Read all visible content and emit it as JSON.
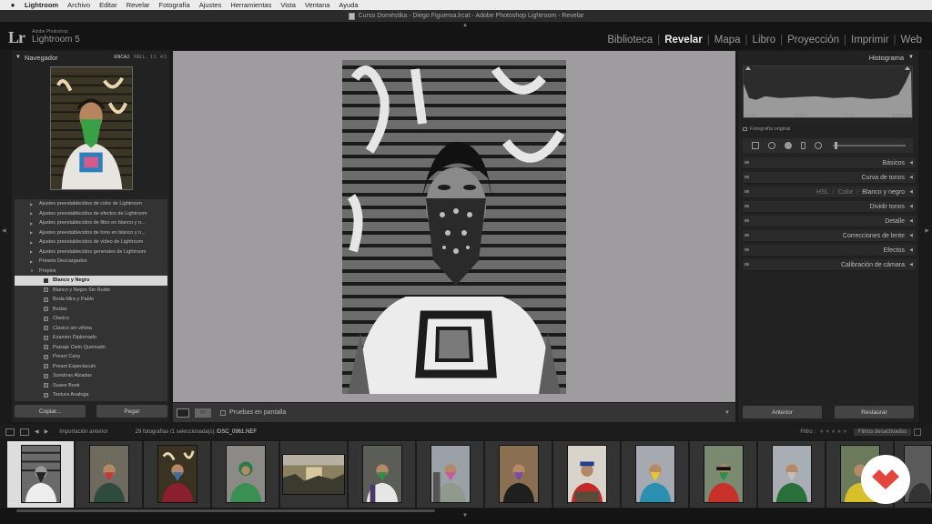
{
  "menubar": {
    "apple": "",
    "items": [
      "Lightroom",
      "Archivo",
      "Editar",
      "Revelar",
      "Fotografía",
      "Ajustes",
      "Herramientas",
      "Vista",
      "Ventana",
      "Ayuda"
    ]
  },
  "window": {
    "title": "Curso Doméstika - Diego Figueroa.lrcat - Adobe Photoshop Lightroom - Revelar"
  },
  "identity": {
    "logo": "Lr",
    "brand_small": "Adobe Photoshop",
    "brand_big": "Lightroom 5"
  },
  "modules": [
    {
      "label": "Biblioteca",
      "active": false
    },
    {
      "label": "Revelar",
      "active": true
    },
    {
      "label": "Mapa",
      "active": false
    },
    {
      "label": "Libro",
      "active": false
    },
    {
      "label": "Proyección",
      "active": false
    },
    {
      "label": "Imprimir",
      "active": false
    },
    {
      "label": "Web",
      "active": false
    }
  ],
  "navigator": {
    "title": "Navegador",
    "zoom": [
      "ENCAJ.",
      "RELL.",
      "1:1",
      "4:1"
    ]
  },
  "presets": {
    "rows": [
      {
        "label": "Ajustes preestablecidos de color de Lightroom",
        "kind": "group"
      },
      {
        "label": "Ajustes preestablecidos de efectos de Lightroom",
        "kind": "group"
      },
      {
        "label": "Ajustes preestablecidos de filtro en blanco y n...",
        "kind": "group"
      },
      {
        "label": "Ajustes preestablecidos de tono en blanco y n...",
        "kind": "group"
      },
      {
        "label": "Ajustes preestablecidos de vídeo de Lightroom",
        "kind": "group"
      },
      {
        "label": "Ajustes preestablecidos generales de Lightroom",
        "kind": "group"
      },
      {
        "label": "Presets Descargados",
        "kind": "group"
      },
      {
        "label": "Propios",
        "kind": "group-open"
      },
      {
        "label": "Blanco y Negro",
        "kind": "item",
        "selected": true
      },
      {
        "label": "Blanco y Negro Sin Ruido",
        "kind": "item"
      },
      {
        "label": "Boda Mira y Pablo",
        "kind": "item"
      },
      {
        "label": "Bodas",
        "kind": "item"
      },
      {
        "label": "Clasico",
        "kind": "item"
      },
      {
        "label": "Clasico sin viñeta",
        "kind": "item"
      },
      {
        "label": "Examen Diplomado",
        "kind": "item"
      },
      {
        "label": "Paisaje Cielo Quemado",
        "kind": "item"
      },
      {
        "label": "Preset Cany",
        "kind": "item"
      },
      {
        "label": "Preset Espectaculo",
        "kind": "item"
      },
      {
        "label": "Sombras Alzadas",
        "kind": "item",
        "italic": true
      },
      {
        "label": "Suave Book",
        "kind": "item"
      },
      {
        "label": "Textura Analoga",
        "kind": "item"
      }
    ]
  },
  "left_buttons": {
    "copy": "Copiar...",
    "paste": "Pegar"
  },
  "toolbar": {
    "softproof": "Pruebas en pantalla"
  },
  "histogram": {
    "title": "Histograma",
    "info": [
      "ISO 64",
      "13 mm",
      "f / 2,8",
      "1/1000 seg"
    ],
    "original": "Fotografía original"
  },
  "sections": [
    {
      "label": "Básicos"
    },
    {
      "label": "Curva de tonos"
    },
    {
      "label": "HSL / Color / Blanco y negro",
      "parts": [
        "HSL",
        "Color",
        "Blanco y negro"
      ]
    },
    {
      "label": "Dividir tonos"
    },
    {
      "label": "Detalle"
    },
    {
      "label": "Correcciones de lente"
    },
    {
      "label": "Efectos"
    },
    {
      "label": "Calibración de cámara"
    }
  ],
  "right_buttons": {
    "prev": "Anterior",
    "reset": "Restaurar"
  },
  "filmstrip": {
    "source": "Importación anterior",
    "count": "29 fotografías /1 seleccionada(s) /",
    "file": "DSC_0961.NEF",
    "filter_label": "Filtro :",
    "filters_state": "Filtros desactivados"
  },
  "colors": {
    "accent_selected": "#d8d8d8",
    "panel": "#222222",
    "center_bg": "#9e9c9f",
    "brand_red": "#e2463c"
  }
}
